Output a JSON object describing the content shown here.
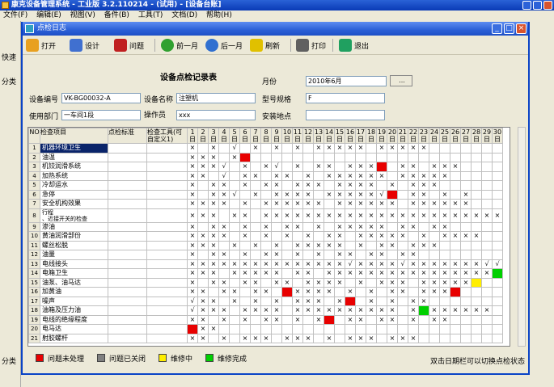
{
  "app": {
    "title": "康克设备管理系统 - 工业版 3.2.110214 - (试用) - [设备台账]",
    "menu": [
      "文件(F)",
      "编辑(E)",
      "视图(V)",
      "备件(B)",
      "工具(T)",
      "文档(D)",
      "帮助(H)"
    ],
    "left_labels": [
      "快速",
      "分类",
      "分类"
    ]
  },
  "window": {
    "title": "点检日志",
    "toolbar": [
      {
        "label": "打开",
        "icon": "open-folder-icon",
        "color": "#e8a020"
      },
      {
        "label": "设计",
        "icon": "design-pencil-icon",
        "color": "#4070d0"
      },
      {
        "label": "问题",
        "icon": "problem-note-icon",
        "color": "#c02020"
      },
      {
        "label": "前一月",
        "icon": "prev-month-icon",
        "color": "#30a030"
      },
      {
        "label": "后一月",
        "icon": "next-month-icon",
        "color": "#3070d0"
      },
      {
        "label": "刷新",
        "icon": "refresh-lightning-icon",
        "color": "#e0c000"
      },
      {
        "label": "打印",
        "icon": "printer-icon",
        "color": "#606060"
      },
      {
        "label": "退出",
        "icon": "exit-door-icon",
        "color": "#20a060"
      }
    ]
  },
  "form": {
    "heading": "设备点检记录表",
    "month_label": "月份",
    "month_value": "2010年6月",
    "month_button": "...",
    "code_label": "设备编号",
    "code_value": "VK-BG00032-A",
    "name_label": "设备名称",
    "name_value": "注塑机",
    "model_label": "型号规格",
    "model_value": "F",
    "dept_label": "使用部门",
    "dept_value": "一车间1段",
    "operator_label": "操作员",
    "operator_value": "xxx",
    "location_label": "安装地点",
    "location_value": ""
  },
  "grid": {
    "headers": {
      "no": "NO",
      "item": "检查项目",
      "std": "点检标准",
      "tool": "检查工具(可自定义1)"
    },
    "day_suffix": "日",
    "days": [
      "1",
      "2",
      "3",
      "4",
      "5",
      "6",
      "7",
      "8",
      "9",
      "10",
      "11",
      "12",
      "13",
      "14",
      "15",
      "16",
      "17",
      "18",
      "19",
      "20",
      "21",
      "22",
      "23",
      "24",
      "25",
      "26",
      "27",
      "28",
      "29",
      "30"
    ],
    "rows": [
      {
        "no": "1",
        "item": "机器环境卫生",
        "cells": "X X √ X X X XXXXX XXXXX"
      },
      {
        "no": "2",
        "item": "油温",
        "cells": "XXX XR"
      },
      {
        "no": "3",
        "item": "机铰润滑系统",
        "cells": "XXX√ X X√ X XX XXXR XX XXX"
      },
      {
        "no": "4",
        "item": "加热系统",
        "cells": "XX √ XX XX X XXXXXX XXXXX"
      },
      {
        "no": "5",
        "item": "冷却运水",
        "cells": "X XX X XX XXX XXXX X XXX"
      },
      {
        "no": "6",
        "item": "急停",
        "cells": "X XX√ X XXXX XXXXX√R XX X X"
      },
      {
        "no": "7",
        "item": "安全机构效果",
        "cells": "XXXX X XXXXXX XXXXXX XXXXXX"
      },
      {
        "no": "8",
        "item": "行程\n、近接开关的检查",
        "cells": "XXX XX XXXXXXXXXXXXXXXXXXXXXXX"
      },
      {
        "no": "9",
        "item": "渗油",
        "cells": "X XX X X XX X XXXXX XX XX"
      },
      {
        "no": "10",
        "item": "黄油润滑部份",
        "cells": "XXXX X X X X XX XXXXX X XXXX"
      },
      {
        "no": "11",
        "item": "螺丝松脱",
        "cells": "XXX X X X XXXXX X XX XXX"
      },
      {
        "no": "12",
        "item": "油量",
        "cells": "X XX X XX X X XX XX XX"
      },
      {
        "no": "13",
        "item": "电线接头",
        "cells": "XXXXXXXXXXXXXXX√XXXX√XXXXXXX√√R"
      },
      {
        "no": "14",
        "item": "电箱卫生",
        "cells": "XXX XXXXX XX XXXXXXXXXXXXXXXXG"
      },
      {
        "no": "15",
        "item": "油泵、油马达",
        "cells": "X XX XX XX XXXX X XXX XXXXXY"
      },
      {
        "no": "16",
        "item": "加黄油",
        "cells": "XX XX XX RXXXX X X XX XXXR"
      },
      {
        "no": "17",
        "item": "噪声",
        "cells": "√XX X X X XXX XR X X XX"
      },
      {
        "no": "18",
        "item": "油箱及压力油",
        "cells": "√XXX XXXX XXXXXXXXXX XGXXXXXX"
      },
      {
        "no": "19",
        "item": "电线的绝缘程度",
        "cells": "XX X X XX X XR XX XX X XX"
      },
      {
        "no": "20",
        "item": "电马达",
        "cells": "RXX"
      },
      {
        "no": "21",
        "item": "射胶螺杆",
        "cells": "XX X XXX XXX X XXX XXX"
      }
    ]
  },
  "legend": [
    {
      "label": "问题未处理",
      "color": "#e80000"
    },
    {
      "label": "问题已关闭",
      "color": "#808080"
    },
    {
      "label": "维修中",
      "color": "#ffee00"
    },
    {
      "label": "维修完成",
      "color": "#00d000"
    }
  ],
  "hint": "双击日期栏可以切换点检状态"
}
